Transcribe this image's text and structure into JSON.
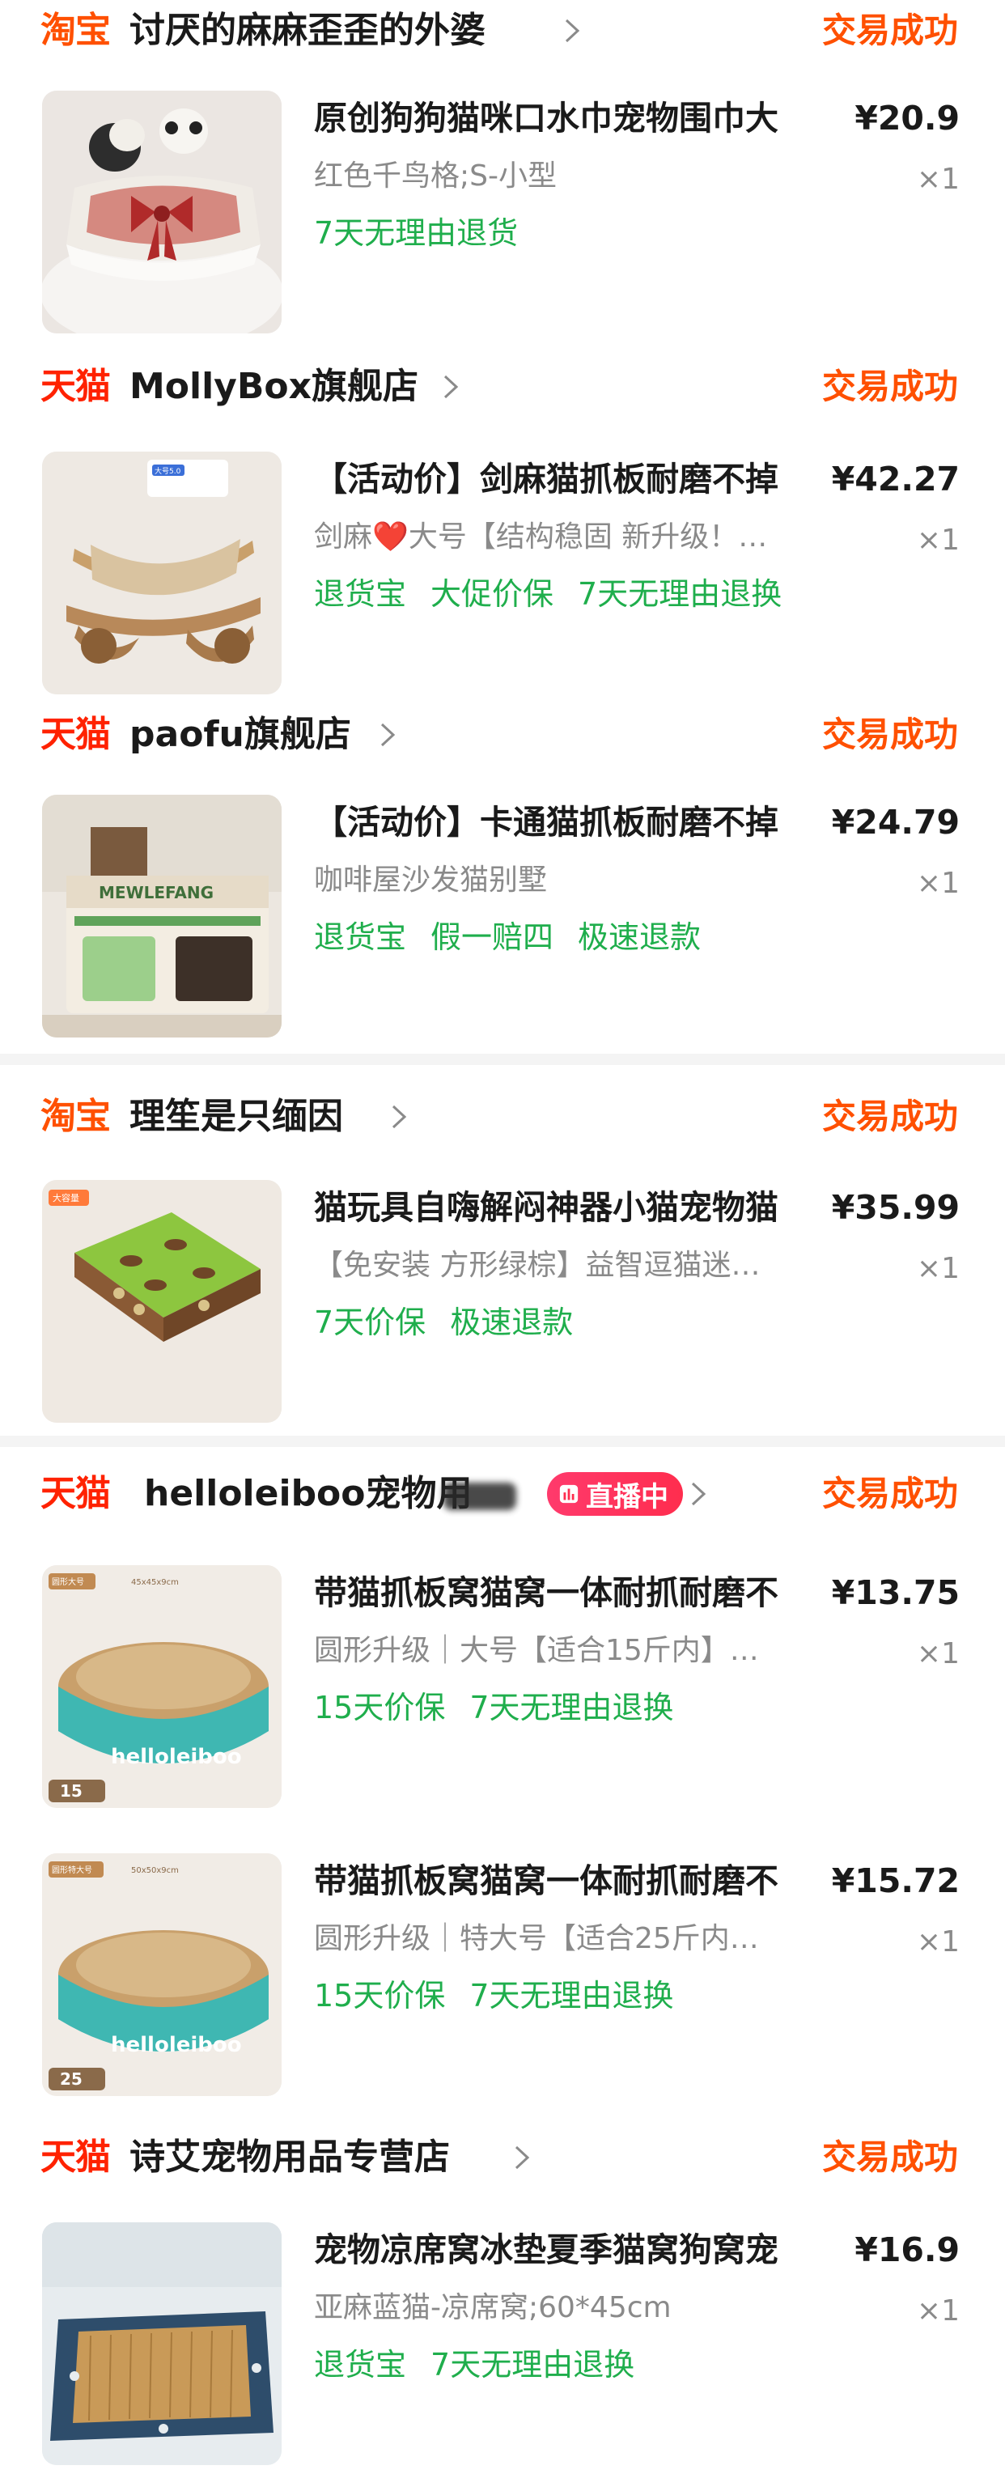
{
  "orders": [
    {
      "platform": "淘宝",
      "shop": "讨厌的麻麻歪歪的外婆",
      "status": "交易成功",
      "items": [
        {
          "title": "原创狗狗猫咪口水巾宠物围巾大",
          "price": "¥20.9",
          "sku": "红色千鸟格;S-小型",
          "qty": "×1",
          "tags": [
            "7天无理由退货"
          ]
        }
      ]
    },
    {
      "platform": "天猫",
      "shop": "MollyBox旗舰店",
      "status": "交易成功",
      "items": [
        {
          "title": "【活动价】剑麻猫抓板耐磨不掉",
          "price": "¥42.27",
          "sku": "剑麻❤️大号【结构稳固 新升级！…",
          "qty": "×1",
          "tags": [
            "退货宝",
            "大促价保",
            "7天无理由退换"
          ]
        }
      ]
    },
    {
      "platform": "天猫",
      "shop": "paofu旗舰店",
      "status": "交易成功",
      "items": [
        {
          "title": "【活动价】卡通猫抓板耐磨不掉",
          "price": "¥24.79",
          "sku": "咖啡屋沙发猫别墅",
          "qty": "×1",
          "tags": [
            "退货宝",
            "假一赔四",
            "极速退款"
          ]
        }
      ]
    },
    {
      "platform": "淘宝",
      "shop": "理笙是只缅因",
      "status": "交易成功",
      "items": [
        {
          "title": "猫玩具自嗨解闷神器小猫宠物猫",
          "price": "¥35.99",
          "sku": "【免安装 方形绿棕】益智逗猫迷…",
          "qty": "×1",
          "tags": [
            "7天价保",
            "极速退款"
          ]
        }
      ]
    },
    {
      "platform": "天猫",
      "shop": "helloleiboo宠物用",
      "live": "直播中",
      "status": "交易成功",
      "items": [
        {
          "title": "带猫抓板窝猫窝一体耐抓耐磨不",
          "price": "¥13.75",
          "sku": "圆形升级｜大号【适合15斤内】…",
          "qty": "×1",
          "tags": [
            "15天价保",
            "7天无理由退换"
          ]
        },
        {
          "title": "带猫抓板窝猫窝一体耐抓耐磨不",
          "price": "¥15.72",
          "sku": "圆形升级｜特大号【适合25斤内…",
          "qty": "×1",
          "tags": [
            "15天价保",
            "7天无理由退换"
          ]
        }
      ]
    },
    {
      "platform": "天猫",
      "shop": "诗艾宠物用品专营店",
      "status": "交易成功",
      "items": [
        {
          "title": "宠物凉席窝冰垫夏季猫窝狗窝宠",
          "price": "¥16.9",
          "sku": "亚麻蓝猫-凉席窝;60*45cm",
          "qty": "×1",
          "tags": [
            "退货宝",
            "7天无理由退换"
          ]
        }
      ]
    }
  ],
  "thumb_text": {
    "mollybox_badge": "大号5.0",
    "paofu_sign": "MEWLEFANG",
    "lsm_badge": "大容量",
    "hb_brand": "helloleiboo",
    "hb1_label": "圆形大号",
    "hb1_size": "45x45x9cm",
    "hb1_weight": "15",
    "hb2_label": "圆形特大号",
    "hb2_size": "50x50x9cm",
    "hb2_weight": "25"
  },
  "colors": {
    "tmall": "#ff2200",
    "taobao": "#ff5000",
    "status": "#ff5000",
    "tag_green": "#1fae4c",
    "live_badge": "#ff2d4e"
  }
}
